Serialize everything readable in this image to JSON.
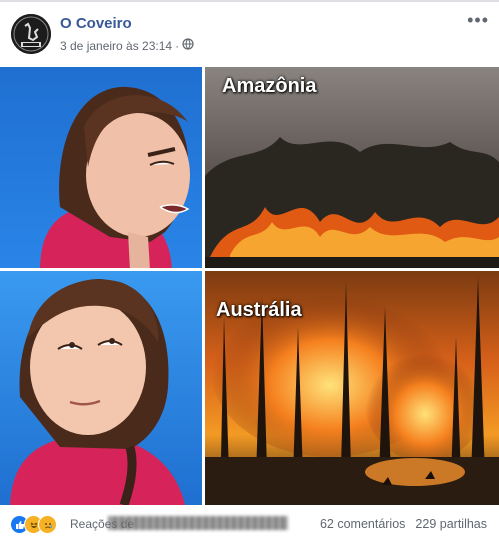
{
  "post": {
    "page_name": "O Coveiro",
    "timestamp": "3 de janeiro às 23:14",
    "privacy_icon": "globe-icon",
    "more_icon": "more-options-icon"
  },
  "image": {
    "caption_top": "Amazônia",
    "caption_bottom": "Austrália"
  },
  "footer": {
    "reactions": [
      "like-icon",
      "haha-icon",
      "sad-icon"
    ],
    "names_prefix": "Reações de",
    "comments": "62 comentários",
    "shares": "229 partilhas"
  },
  "colors": {
    "brand_link": "#385898",
    "meta_text": "#606770",
    "like": "#1877f2",
    "haha": "#f7b125"
  }
}
